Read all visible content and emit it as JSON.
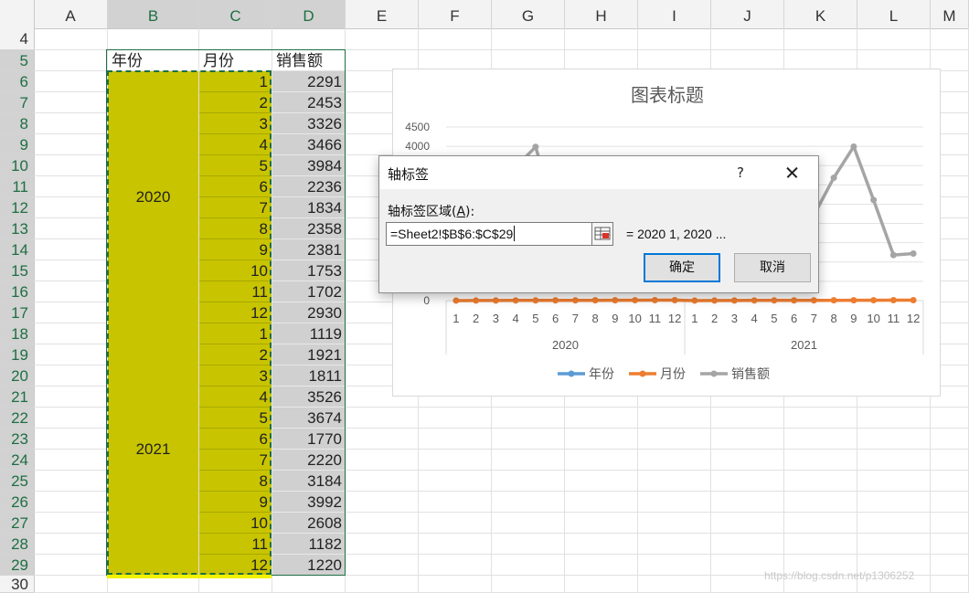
{
  "columns": [
    "A",
    "B",
    "C",
    "D",
    "E",
    "F",
    "G",
    "H",
    "I",
    "J",
    "K",
    "L",
    "M"
  ],
  "rows": [
    "4",
    "5",
    "6",
    "7",
    "8",
    "9",
    "10",
    "11",
    "12",
    "13",
    "14",
    "15",
    "16",
    "17",
    "18",
    "19",
    "20",
    "21",
    "22",
    "23",
    "24",
    "25",
    "26",
    "27",
    "28",
    "29",
    "30"
  ],
  "header_row": {
    "year": "年份",
    "month": "月份",
    "sales": "销售额"
  },
  "year_groups": [
    "2020",
    "2021"
  ],
  "months": [
    "1",
    "2",
    "3",
    "4",
    "5",
    "6",
    "7",
    "8",
    "9",
    "10",
    "11",
    "12",
    "1",
    "2",
    "3",
    "4",
    "5",
    "6",
    "7",
    "8",
    "9",
    "10",
    "11",
    "12"
  ],
  "sales": [
    "2291",
    "2453",
    "3326",
    "3466",
    "3984",
    "2236",
    "1834",
    "2358",
    "2381",
    "1753",
    "1702",
    "2930",
    "1119",
    "1921",
    "1811",
    "3526",
    "3674",
    "1770",
    "2220",
    "3184",
    "3992",
    "2608",
    "1182",
    "1220"
  ],
  "colors": {
    "selection_fill": "#c8c400",
    "sales_fill": "#d0d0d0",
    "excel_green": "#1f6e43",
    "series_year": "#5b9bd5",
    "series_month": "#ed7d31",
    "series_sales": "#a5a5a5",
    "ok_border": "#0078d7"
  },
  "chart_data": {
    "type": "line",
    "title": "图表标题",
    "y_ticks_visible": [
      "4500",
      "4000",
      "0"
    ],
    "ylim": [
      0,
      4500
    ],
    "categories": [
      "1",
      "2",
      "3",
      "4",
      "5",
      "6",
      "7",
      "8",
      "9",
      "10",
      "11",
      "12",
      "1",
      "2",
      "3",
      "4",
      "5",
      "6",
      "7",
      "8",
      "9",
      "10",
      "11",
      "12"
    ],
    "category_groups": [
      "2020",
      "2021"
    ],
    "series": [
      {
        "name": "年份",
        "color": "#5b9bd5",
        "values": []
      },
      {
        "name": "月份",
        "color": "#ed7d31",
        "values": [
          1,
          2,
          3,
          4,
          5,
          6,
          7,
          8,
          9,
          10,
          11,
          12,
          1,
          2,
          3,
          4,
          5,
          6,
          7,
          8,
          9,
          10,
          11,
          12
        ]
      },
      {
        "name": "销售额",
        "color": "#a5a5a5",
        "values": [
          2291,
          2453,
          3326,
          3466,
          3984,
          2236,
          1834,
          2358,
          2381,
          1753,
          1702,
          2930,
          1119,
          1921,
          1811,
          3526,
          3674,
          1770,
          2220,
          3184,
          3992,
          2608,
          1182,
          1220
        ]
      }
    ],
    "legend_position": "bottom"
  },
  "dialog": {
    "title": "轴标签",
    "help": "?",
    "label_prefix": "轴标签区域(",
    "label_accel": "A",
    "label_suffix": "):",
    "input_value": "=Sheet2!$B$6:$C$29",
    "preview": "= 2020  1, 2020 ...",
    "ok_label": "确定",
    "cancel_label": "取消"
  },
  "watermark": "https://blog.csdn.net/p1306252"
}
